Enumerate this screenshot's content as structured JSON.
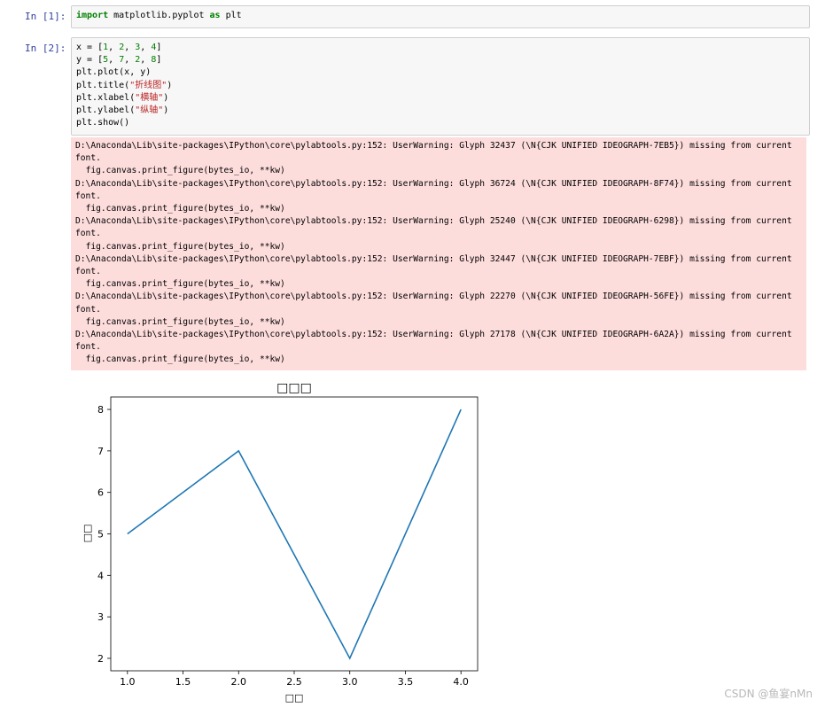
{
  "cells": [
    {
      "prompt": "In  [1]:",
      "lines": [
        [
          {
            "t": "import",
            "c": "kw"
          },
          {
            "t": " matplotlib.pyplot ",
            "c": ""
          },
          {
            "t": "as",
            "c": "kw"
          },
          {
            "t": " plt",
            "c": ""
          }
        ]
      ]
    },
    {
      "prompt": "In  [2]:",
      "lines": [
        [
          {
            "t": "x = [",
            "c": ""
          },
          {
            "t": "1",
            "c": "num"
          },
          {
            "t": ", ",
            "c": ""
          },
          {
            "t": "2",
            "c": "num"
          },
          {
            "t": ", ",
            "c": ""
          },
          {
            "t": "3",
            "c": "num"
          },
          {
            "t": ", ",
            "c": ""
          },
          {
            "t": "4",
            "c": "num"
          },
          {
            "t": "]",
            "c": ""
          }
        ],
        [
          {
            "t": "y = [",
            "c": ""
          },
          {
            "t": "5",
            "c": "num"
          },
          {
            "t": ", ",
            "c": ""
          },
          {
            "t": "7",
            "c": "num"
          },
          {
            "t": ", ",
            "c": ""
          },
          {
            "t": "2",
            "c": "num"
          },
          {
            "t": ", ",
            "c": ""
          },
          {
            "t": "8",
            "c": "num"
          },
          {
            "t": "]",
            "c": ""
          }
        ],
        [
          {
            "t": "plt.plot(x, y)",
            "c": ""
          }
        ],
        [
          {
            "t": "plt.title(",
            "c": ""
          },
          {
            "t": "\"折线图\"",
            "c": "str"
          },
          {
            "t": ")",
            "c": ""
          }
        ],
        [
          {
            "t": "plt.xlabel(",
            "c": ""
          },
          {
            "t": "\"横轴\"",
            "c": "str"
          },
          {
            "t": ")",
            "c": ""
          }
        ],
        [
          {
            "t": "plt.ylabel(",
            "c": ""
          },
          {
            "t": "\"纵轴\"",
            "c": "str"
          },
          {
            "t": ")",
            "c": ""
          }
        ],
        [
          {
            "t": "plt.show()",
            "c": ""
          }
        ]
      ]
    }
  ],
  "stderr_lines": [
    "D:\\Anaconda\\Lib\\site-packages\\IPython\\core\\pylabtools.py:152: UserWarning: Glyph 32437 (\\N{CJK UNIFIED IDEOGRAPH-7EB5}) missing from current",
    "font.",
    "  fig.canvas.print_figure(bytes_io, **kw)",
    "D:\\Anaconda\\Lib\\site-packages\\IPython\\core\\pylabtools.py:152: UserWarning: Glyph 36724 (\\N{CJK UNIFIED IDEOGRAPH-8F74}) missing from current",
    "font.",
    "  fig.canvas.print_figure(bytes_io, **kw)",
    "D:\\Anaconda\\Lib\\site-packages\\IPython\\core\\pylabtools.py:152: UserWarning: Glyph 25240 (\\N{CJK UNIFIED IDEOGRAPH-6298}) missing from current",
    "font.",
    "  fig.canvas.print_figure(bytes_io, **kw)",
    "D:\\Anaconda\\Lib\\site-packages\\IPython\\core\\pylabtools.py:152: UserWarning: Glyph 32447 (\\N{CJK UNIFIED IDEOGRAPH-7EBF}) missing from current",
    "font.",
    "  fig.canvas.print_figure(bytes_io, **kw)",
    "D:\\Anaconda\\Lib\\site-packages\\IPython\\core\\pylabtools.py:152: UserWarning: Glyph 22270 (\\N{CJK UNIFIED IDEOGRAPH-56FE}) missing from current",
    "font.",
    "  fig.canvas.print_figure(bytes_io, **kw)",
    "D:\\Anaconda\\Lib\\site-packages\\IPython\\core\\pylabtools.py:152: UserWarning: Glyph 27178 (\\N{CJK UNIFIED IDEOGRAPH-6A2A}) missing from current",
    "font.",
    "  fig.canvas.print_figure(bytes_io, **kw)"
  ],
  "chart_data": {
    "type": "line",
    "x": [
      1,
      2,
      3,
      4
    ],
    "series": [
      {
        "values": [
          5,
          7,
          2,
          8
        ],
        "color": "#1f77b4"
      }
    ],
    "title": "□□□",
    "xlabel": "□□",
    "ylabel": "□□",
    "xlim": [
      0.85,
      4.15
    ],
    "ylim": [
      1.7,
      8.3
    ],
    "xticks": [
      "1.0",
      "1.5",
      "2.0",
      "2.5",
      "3.0",
      "3.5",
      "4.0"
    ],
    "yticks": [
      "2",
      "3",
      "4",
      "5",
      "6",
      "7",
      "8"
    ],
    "grid": false
  },
  "watermark": "CSDN @鱼宴nMn"
}
